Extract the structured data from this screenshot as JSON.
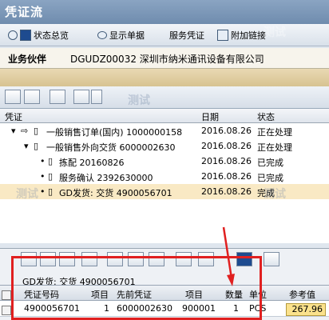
{
  "window": {
    "title": "凭证流"
  },
  "toolbar": {
    "status_overview": "状态总览",
    "show_document": "显示单据",
    "service_document": "服务凭证",
    "additional_links": "附加链接"
  },
  "partner": {
    "label": "业务伙伴",
    "value": "DGUDZ00032 深圳市纳米通讯设备有限公司"
  },
  "tree_header": {
    "document": "凭证",
    "date": "日期",
    "status": "状态"
  },
  "tree": [
    {
      "text": "一般销售订单(国内) 1000000158",
      "date": "2016.08.26",
      "status": "正在处理"
    },
    {
      "text": "一般销售外向交货 6000002630",
      "date": "2016.08.26",
      "status": "正在处理"
    },
    {
      "text": "拣配 20160826",
      "date": "2016.08.26",
      "status": "已完成"
    },
    {
      "text": "服务确认 2392630000",
      "date": "2016.08.26",
      "status": "已完成"
    },
    {
      "text": "GD发货: 交货 4900056701",
      "date": "2016.08.26",
      "status": "完成"
    }
  ],
  "detail": {
    "title": "GD发货: 交货 4900056701",
    "columns": [
      "凭证号码",
      "项目",
      "先前凭证",
      "项目",
      "数量",
      "单位",
      "参考值"
    ],
    "row": [
      "4900056701",
      "1",
      "6000002630",
      "900001",
      "1",
      "PCS",
      "267.96"
    ]
  },
  "watermark": "测试"
}
